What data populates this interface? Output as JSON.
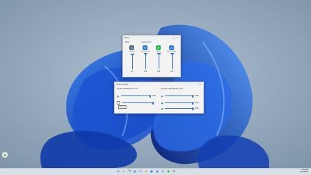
{
  "mixer": {
    "title": "Mixer",
    "headers": {
      "left": "Mixer",
      "right": "Applications"
    },
    "channels": [
      {
        "label": "Speakers",
        "icon": "speaker-icon",
        "color": "#5a6b7c",
        "value": "95",
        "level": 0.95
      },
      {
        "label": "Microsoft Edge",
        "icon": "edge-icon",
        "color": "#2f7dd6",
        "value": "100",
        "level": 1.0
      },
      {
        "label": "Spotify",
        "icon": "spotify-icon",
        "color": "#1db954",
        "value": "100",
        "level": 1.0
      },
      {
        "label": "Microsoft Edge",
        "icon": "edge-icon",
        "color": "#2f7dd6",
        "value": "100",
        "level": 1.0
      }
    ]
  },
  "volume_mixer": {
    "title": "Volume Mixer",
    "left_device": "Speaker Realtek(R) Audio",
    "right_device": "Speakers Realtek(R) Audio",
    "rows": [
      {
        "icon": "speaker-icon",
        "value": "100",
        "level": 1.0
      },
      {
        "icon": "speaker-icon",
        "value": "100",
        "level": 1.0
      },
      {
        "icon": "edge-icon",
        "value": "100",
        "level": 1.0
      },
      {
        "icon": "spotify-icon",
        "value": "100",
        "level": 1.0
      }
    ],
    "tooltip": "Volume"
  },
  "taskbar": {
    "icons": [
      "start-icon",
      "search-icon",
      "task-view-icon",
      "widgets-icon",
      "chat-icon",
      "file-explorer-icon",
      "edge-icon",
      "store-icon",
      "mail-icon",
      "spotify-icon",
      "settings-icon"
    ],
    "time": "2:58 PM",
    "date": "1/21/2022"
  },
  "colors": {
    "accent": "#2e6fd6",
    "wallpaper_bg": "#8fa4b8",
    "bloom": "#1747b8"
  }
}
